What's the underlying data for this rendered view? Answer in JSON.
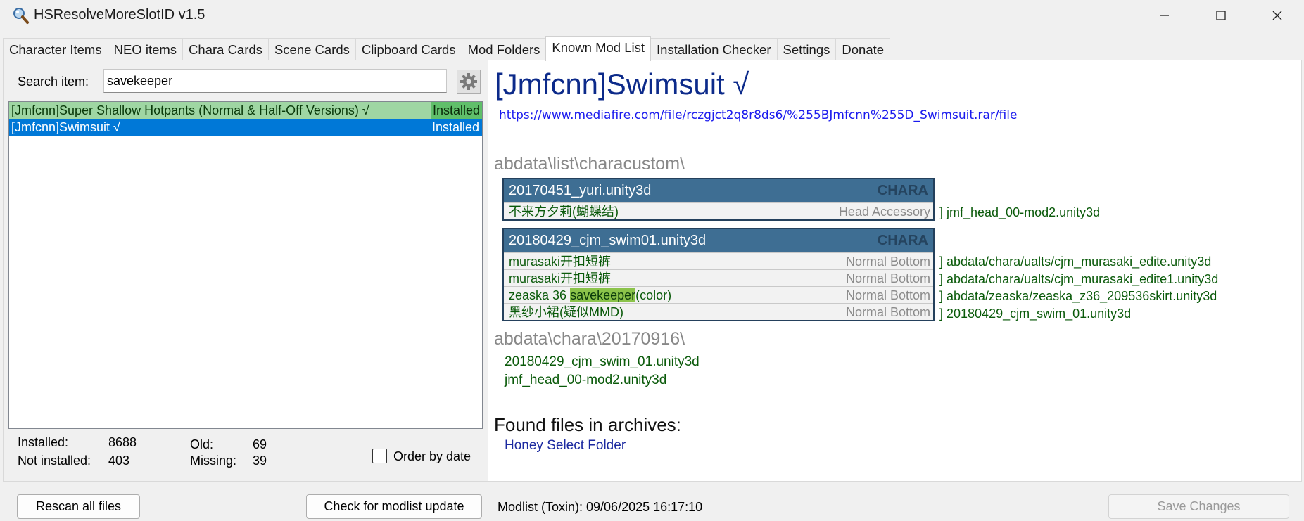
{
  "app": {
    "title": "HSResolveMoreSlotID v1.5",
    "icon": "magnifier-app-icon"
  },
  "tabs": [
    {
      "label": "Character Items",
      "active": false
    },
    {
      "label": "NEO items",
      "active": false
    },
    {
      "label": "Chara Cards",
      "active": false
    },
    {
      "label": "Scene Cards",
      "active": false
    },
    {
      "label": "Clipboard Cards",
      "active": false
    },
    {
      "label": "Mod Folders",
      "active": false
    },
    {
      "label": "Known Mod List",
      "active": true
    },
    {
      "label": "Installation Checker",
      "active": false
    },
    {
      "label": "Settings",
      "active": false
    },
    {
      "label": "Donate",
      "active": false
    }
  ],
  "search": {
    "label": "Search item:",
    "value": "savekeeper"
  },
  "mod_list": [
    {
      "name": "[Jmfcnn]Super Shallow Hotpants (Normal & Half-Off Versions) √",
      "status": "Installed",
      "state": "installed-highlight"
    },
    {
      "name": "[Jmfcnn]Swimsuit √",
      "status": "Installed",
      "state": "selected"
    }
  ],
  "stats": {
    "installed_label": "Installed:",
    "installed_value": "8688",
    "not_installed_label": "Not installed:",
    "not_installed_value": "403",
    "old_label": "Old:",
    "old_value": "69",
    "missing_label": "Missing:",
    "missing_value": "39"
  },
  "order_by_date": {
    "label": "Order by date",
    "checked": false
  },
  "detail": {
    "title": "[Jmfcnn]Swimsuit √",
    "link": "https://www.mediafire.com/file/rczgjct2q8r8ds6/%255BJmfcnn%255D_Swimsuit.rar/file",
    "sections": [
      {
        "path": "abdata\\list\\characustom\\",
        "cards": [
          {
            "file": "20170451_yuri.unity3d",
            "kind": "CHARA",
            "rows": [
              {
                "name": "不来方夕莉(蝴蝶结)",
                "type": "Head Accessory",
                "target": "] jmf_head_00-mod2.unity3d"
              }
            ]
          },
          {
            "file": "20180429_cjm_swim01.unity3d",
            "kind": "CHARA",
            "rows": [
              {
                "name": "murasaki开扣短裤",
                "type": "Normal Bottom",
                "target": "] abdata/chara/ualts/cjm_murasaki_edite.unity3d"
              },
              {
                "name": "murasaki开扣短裤",
                "type": "Normal Bottom",
                "target": "] abdata/chara/ualts/cjm_murasaki_edite1.unity3d"
              },
              {
                "name_prefix": "zeaska 36 ",
                "name_highlight": "savekeeper",
                "name_suffix": "(color)",
                "type": "Normal Bottom",
                "target": "] abdata/zeaska/zeaska_z36_209536skirt.unity3d"
              },
              {
                "name": "黑纱小裙(疑似MMD)",
                "type": "Normal Bottom",
                "target": "] 20180429_cjm_swim_01.unity3d"
              }
            ]
          }
        ]
      },
      {
        "path": "abdata\\chara\\20170916\\",
        "files": [
          "20180429_cjm_swim_01.unity3d",
          "jmf_head_00-mod2.unity3d"
        ]
      }
    ],
    "found_heading": "Found files in archives:",
    "found_items": [
      "Honey Select Folder"
    ]
  },
  "footer": {
    "rescan_label": "Rescan all files",
    "check_update_label": "Check for modlist update",
    "modlist_status": "Modlist (Toxin): 09/06/2025 16:17:10",
    "save_label": "Save Changes"
  },
  "colors": {
    "accent": "#0078d7",
    "installed_green": "#9fd6a3",
    "card_header": "#3e6e93",
    "title_blue": "#0c2a8a",
    "file_green": "#0a5a0a",
    "highlight": "#8bc34a"
  }
}
